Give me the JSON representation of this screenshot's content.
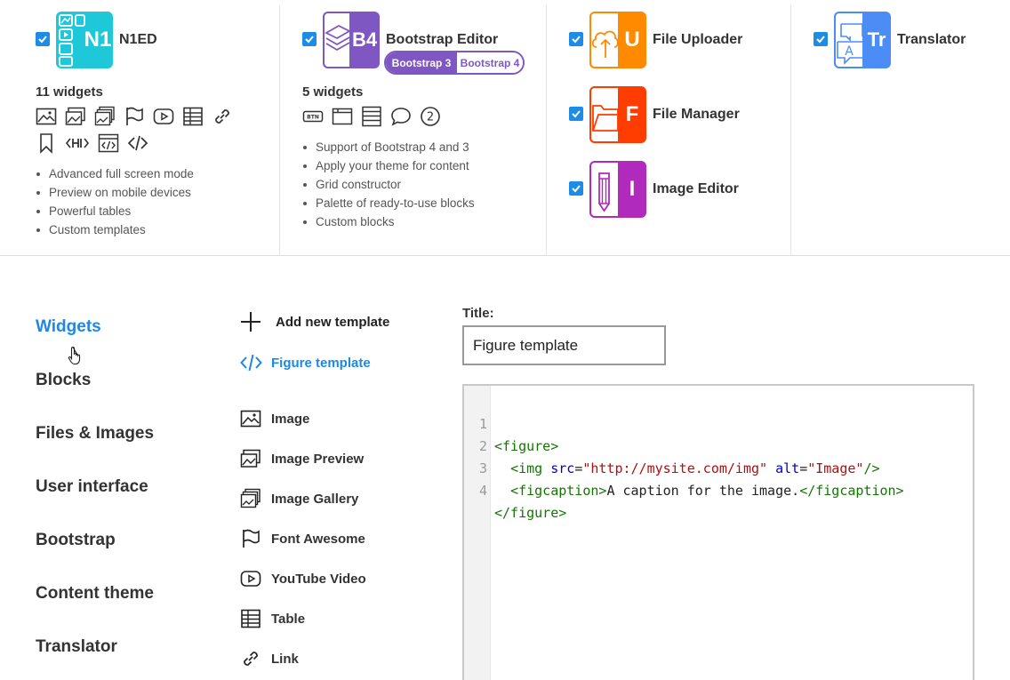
{
  "plugins": {
    "n1ed": {
      "name": "N1ED",
      "logo_text": "N1",
      "widget_count": "11 widgets",
      "features": [
        "Advanced full screen mode",
        "Preview on mobile devices",
        "Powerful tables",
        "Custom templates"
      ],
      "icons": [
        "image-icon",
        "image-preview-icon",
        "image-gallery-icon",
        "flag-icon",
        "youtube-icon",
        "table-icon",
        "link-icon",
        "bookmark-icon",
        "heading-icon",
        "html-icon",
        "code-icon"
      ]
    },
    "bootstrap": {
      "name": "Bootstrap Editor",
      "logo_text": "B4",
      "badge_left": "Bootstrap 3",
      "badge_right": "Bootstrap 4",
      "widget_count": "5 widgets",
      "features": [
        "Support of Bootstrap 4 and 3",
        "Apply your theme for content",
        "Grid constructor",
        "Palette of ready-to-use blocks",
        "Custom blocks"
      ],
      "icons": [
        "button-icon",
        "panel-icon",
        "list-group-icon",
        "comment-icon",
        "number-badge-icon"
      ],
      "badge_number": "2",
      "button_icon_text": "BTN"
    },
    "file_uploader": {
      "name": "File Uploader",
      "logo_text": "U"
    },
    "file_manager": {
      "name": "File Manager",
      "logo_text": "F"
    },
    "image_editor": {
      "name": "Image Editor",
      "logo_text": "I"
    },
    "translator": {
      "name": "Translator",
      "logo_text": "Tr",
      "logo_subtext": "A"
    }
  },
  "colors": {
    "accent": "#1e88e5",
    "n1ed": "#1fc8d8",
    "bootstrap": "#7e57c2",
    "file_uploader": "#ff8a00",
    "file_manager": "#ff3d00",
    "image_editor": "#b02bbb",
    "translator": "#4c8df5"
  },
  "menu": [
    {
      "label": "Widgets",
      "active": true
    },
    {
      "label": "Blocks",
      "active": false
    },
    {
      "label": "Files & Images",
      "active": false
    },
    {
      "label": "User interface",
      "active": false
    },
    {
      "label": "Bootstrap",
      "active": false
    },
    {
      "label": "Content theme",
      "active": false
    },
    {
      "label": "Translator",
      "active": false
    }
  ],
  "templates": {
    "add_label": "Add new template",
    "current_label": "Figure template"
  },
  "widgets": [
    {
      "label": "Image",
      "icon": "image-icon"
    },
    {
      "label": "Image Preview",
      "icon": "image-preview-icon"
    },
    {
      "label": "Image Gallery",
      "icon": "image-gallery-icon"
    },
    {
      "label": "Font Awesome",
      "icon": "flag-icon"
    },
    {
      "label": "YouTube Video",
      "icon": "youtube-icon"
    },
    {
      "label": "Table",
      "icon": "table-icon"
    },
    {
      "label": "Link",
      "icon": "link-icon"
    }
  ],
  "editor": {
    "title_label": "Title:",
    "title_value": "Figure template",
    "line_numbers": [
      "1",
      "2",
      "3",
      "4"
    ],
    "code": {
      "l1_tag": "<figure>",
      "l2_indent": "  ",
      "l2_tag_open": "<img",
      "l2_attr1": "src",
      "l2_eq1": "=",
      "l2_val1": "\"http://mysite.com/img\"",
      "l2_attr2": "alt",
      "l2_eq2": "=",
      "l2_val2": "\"Image\"",
      "l2_tag_close": "/>",
      "l3_indent": "  ",
      "l3_tag_open": "<figcaption>",
      "l3_text": "A caption for the image.",
      "l3_tag_close": "</figcaption>",
      "l4_tag": "</figure>"
    }
  }
}
